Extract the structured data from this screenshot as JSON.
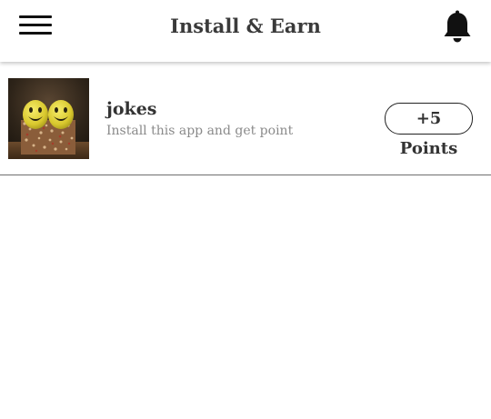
{
  "header": {
    "title": "Install & Earn",
    "menu_icon": "hamburger-menu-icon",
    "notification_icon": "bell-icon"
  },
  "apps": [
    {
      "name": "jokes",
      "description": "Install this app and get point",
      "points_label": "+5 Points",
      "thumbnail": "smiley-faces-image"
    }
  ],
  "colors": {
    "title_text": "#3a3a3a",
    "item_title": "#333333",
    "item_desc": "#8a8a8a",
    "divider": "#6f6f6f",
    "icon": "#111111"
  }
}
